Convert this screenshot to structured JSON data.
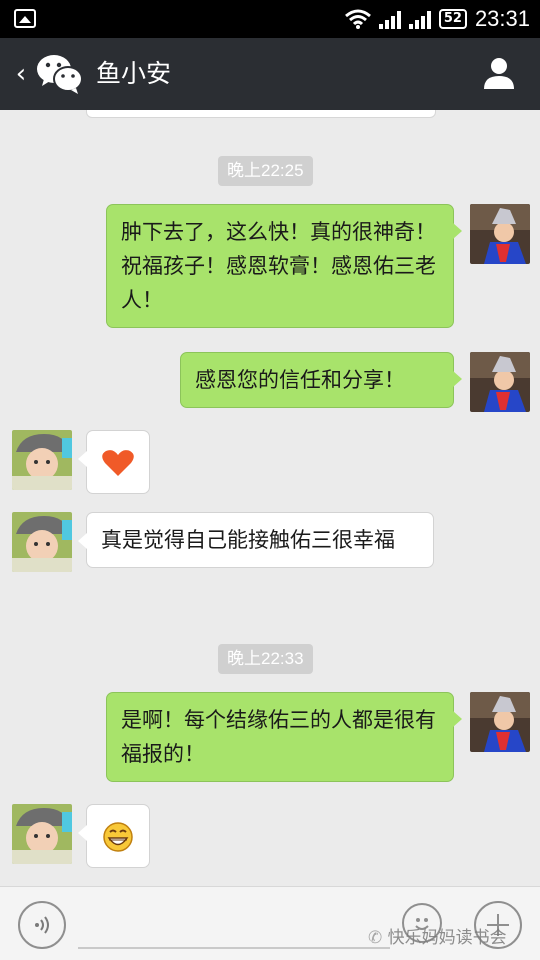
{
  "status_bar": {
    "battery": "52",
    "time": "23:31",
    "icons": [
      "gallery-icon",
      "wifi-icon",
      "signal-icon",
      "battery-icon"
    ]
  },
  "header": {
    "title": "鱼小安",
    "back_icon": "chevron-left-icon",
    "logo_icon": "wechat-logo-icon",
    "profile_icon": "person-icon"
  },
  "messages": [
    {
      "kind": "timestamp",
      "text": "晚上22:25"
    },
    {
      "kind": "out",
      "sender": "self",
      "text": "肿下去了，这么快！真的很神奇！祝福孩子！感恩软膏！感恩佑三老人！"
    },
    {
      "kind": "out",
      "sender": "self",
      "text": "感恩您的信任和分享！"
    },
    {
      "kind": "in",
      "sender": "鱼小安",
      "emoji": "heart-emoji-icon"
    },
    {
      "kind": "in",
      "sender": "鱼小安",
      "text": "真是觉得自己能接触佑三很幸福"
    },
    {
      "kind": "timestamp",
      "text": "晚上22:33"
    },
    {
      "kind": "out",
      "sender": "self",
      "text": "是啊！每个结缘佑三的人都是很有福报的！"
    },
    {
      "kind": "in",
      "sender": "鱼小安",
      "emoji": "grin-emoji-icon"
    }
  ],
  "input_bar": {
    "value": "",
    "placeholder": "",
    "watermark": "快乐妈妈读书会"
  },
  "colors": {
    "header_bg": "#2b2e33",
    "chat_bg": "#ebebeb",
    "outgoing_bubble": "#a8e36b",
    "incoming_bubble": "#ffffff"
  }
}
